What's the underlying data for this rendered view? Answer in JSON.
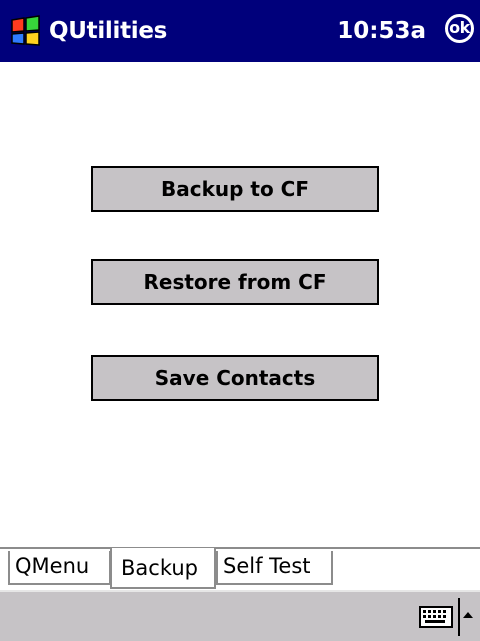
{
  "titlebar": {
    "app_title": "QUtilities",
    "clock": "10:53a",
    "ok_label": "ok",
    "start_icon": "windows-flag-icon",
    "background": "#00007b"
  },
  "main": {
    "buttons": [
      {
        "label": "Backup to CF"
      },
      {
        "label": "Restore from CF"
      },
      {
        "label": "Save Contacts"
      }
    ],
    "button_color": "#c6c3c6"
  },
  "tabs": [
    {
      "label": "QMenu",
      "selected": false
    },
    {
      "label": "Backup",
      "selected": true
    },
    {
      "label": "Self Test",
      "selected": false
    }
  ],
  "command_bar": {
    "keyboard_icon": "keyboard-icon",
    "sip_arrow_icon": "up-arrow-icon",
    "background": "#c6c3c6"
  }
}
